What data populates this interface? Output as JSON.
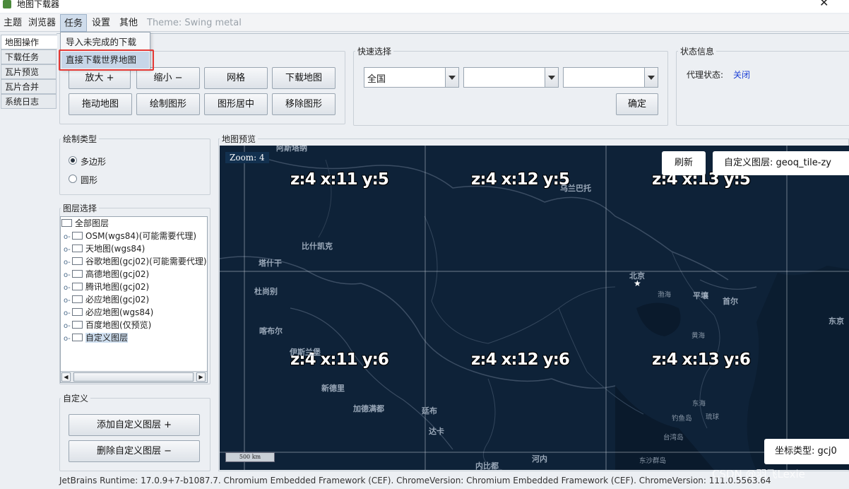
{
  "window": {
    "title": "地图下载器",
    "close_glyph": "✕"
  },
  "menubar": {
    "items": [
      "主题",
      "浏览器",
      "任务",
      "设置",
      "其他"
    ],
    "theme_label": "Theme: Swing metal"
  },
  "task_menu": {
    "items": [
      "导入未完成的下载",
      "直接下载世界地图"
    ]
  },
  "left_tabs": [
    "地图操作",
    "下载任务",
    "瓦片预览",
    "瓦片合并",
    "系统日志"
  ],
  "ops": {
    "buttons_row1": [
      "放大 +",
      "缩小 −",
      "网格",
      "下载地图"
    ],
    "buttons_row2": [
      "拖动地图",
      "绘制图形",
      "图形居中",
      "移除图形"
    ]
  },
  "quick_select": {
    "title": "快速选择",
    "combo1_value": "全国",
    "combo2_value": "",
    "combo3_value": "",
    "confirm_label": "确定"
  },
  "status_info": {
    "title": "状态信息",
    "proxy_label": "代理状态:",
    "proxy_value": "关闭",
    "proxy_color": "#1a3fd6"
  },
  "draw_type": {
    "title": "绘制类型",
    "options": [
      "多边形",
      "圆形"
    ],
    "selected": "多边形"
  },
  "layer_select": {
    "title": "图层选择",
    "root": "全部图层",
    "layers": [
      "OSM(wgs84)(可能需要代理)",
      "天地图(wgs84)",
      "谷歌地图(gcj02)(可能需要代理)",
      "高德地图(gcj02)",
      "腾讯地图(gcj02)",
      "必应地图(gcj02)",
      "必应地图(wgs84)",
      "百度地图(仅预览)",
      "自定义图层"
    ],
    "selected": "自定义图层"
  },
  "custom": {
    "title": "自定义",
    "add_label": "添加自定义图层 +",
    "remove_label": "删除自定义图层 −"
  },
  "map": {
    "title": "地图预览",
    "zoom_text": "Zoom: 4",
    "refresh_label": "刷新",
    "custom_layer_label": "自定义图层: geoq_tile-zy",
    "coord_type_label": "坐标类型: gcj0",
    "scale_text": "500 km",
    "tiles": [
      "z:4 x:11 y:5",
      "z:4 x:12 y:5",
      "z:4 x:13 y:5",
      "z:4 x:11 y:6",
      "z:4 x:12 y:6",
      "z:4 x:13 y:6"
    ],
    "cities": [
      "阿斯塔纳",
      "乌兰巴托",
      "比什凯克",
      "塔什干",
      "杜尚别",
      "北京",
      "渤海",
      "平壤",
      "首尔",
      "黄海",
      "喀布尔",
      "伊斯兰堡",
      "东京",
      "新德里",
      "加德满都",
      "廷布",
      "东海",
      "达卡",
      "钓鱼岛",
      "琉球",
      "台湾岛",
      "内比都",
      "河内",
      "东沙群岛"
    ]
  },
  "statusbar": "JetBrains Runtime: 17.0.9+7-b1087.7. Chromium Embedded Framework (CEF). ChromeVersion: Chromium Embedded Framework (CEF). ChromeVersion: 111.0.5563.64",
  "watermark": "CSDN @羽飞Lexie"
}
